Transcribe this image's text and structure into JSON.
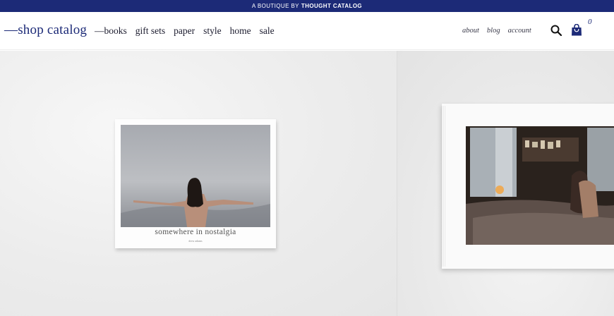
{
  "topbar": {
    "prefix": "A BOUTIQUE BY",
    "brand": "THOUGHT CATALOG"
  },
  "header": {
    "logo": "—shop catalog",
    "main_nav": [
      "—books",
      "gift sets",
      "paper",
      "style",
      "home",
      "sale"
    ],
    "secondary_nav": [
      "about",
      "blog",
      "account"
    ],
    "cart_count": "0"
  },
  "hero": {
    "left_book": {
      "title": "somewhere in nostalgia",
      "author": "drew adams"
    }
  },
  "colors": {
    "brand_navy": "#1c2a77",
    "background": "#ffffff"
  },
  "icons": [
    "search-icon",
    "shopping-bag-icon"
  ]
}
